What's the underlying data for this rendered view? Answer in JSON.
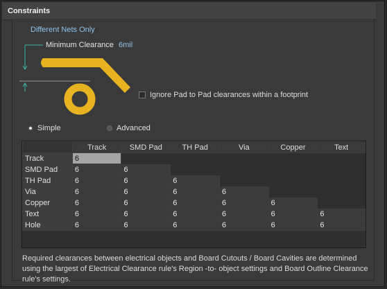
{
  "panel": {
    "title": "Constraints"
  },
  "scope_label": "Different Nets Only",
  "minimum_clearance": {
    "label": "Minimum Clearance",
    "value": "6mil"
  },
  "ignore_pad_checkbox": {
    "label": "Ignore Pad to Pad clearances within a footprint",
    "checked": false
  },
  "mode": {
    "simple_label": "Simple",
    "advanced_label": "Advanced",
    "selected": "Simple"
  },
  "matrix": {
    "columns": [
      "Track",
      "SMD Pad",
      "TH Pad",
      "Via",
      "Copper",
      "Text"
    ],
    "rows": [
      {
        "label": "Track",
        "values": [
          "6"
        ]
      },
      {
        "label": "SMD Pad",
        "values": [
          "6",
          "6"
        ]
      },
      {
        "label": "TH Pad",
        "values": [
          "6",
          "6",
          "6"
        ]
      },
      {
        "label": "Via",
        "values": [
          "6",
          "6",
          "6",
          "6"
        ]
      },
      {
        "label": "Copper",
        "values": [
          "6",
          "6",
          "6",
          "6",
          "6"
        ]
      },
      {
        "label": "Text",
        "values": [
          "6",
          "6",
          "6",
          "6",
          "6",
          "6"
        ]
      },
      {
        "label": "Hole",
        "values": [
          "6",
          "6",
          "6",
          "6",
          "6",
          "6"
        ]
      }
    ]
  },
  "footnote": "Required clearances between electrical objects and Board Cutouts / Board Cavities are determined using the largest of Electrical Clearance rule's Region -to- object settings and Board Outline Clearance rule's settings.",
  "colors": {
    "copper": "#e8b320",
    "accent_text": "#8fc3ea"
  }
}
